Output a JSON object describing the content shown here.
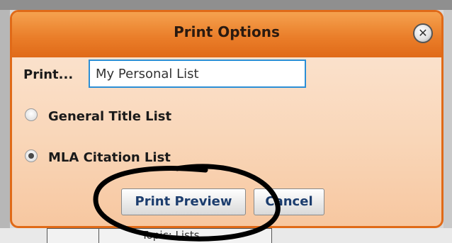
{
  "dialog": {
    "title": "Print Options",
    "close_icon": "close-icon",
    "print_label": "Print...",
    "list_name_value": "My Personal List",
    "options": [
      {
        "label": "General Title List",
        "checked": false
      },
      {
        "label": "MLA Citation List",
        "checked": true
      }
    ],
    "buttons": {
      "print_preview": "Print Preview",
      "cancel": "Cancel"
    }
  },
  "background": {
    "partial_text": "Topic: Lists"
  },
  "colors": {
    "title_bar": "#ea7e2a",
    "dialog_body": "#f9d6b8",
    "input_border": "#2b8fd6",
    "annotation_ellipse": "#000000"
  }
}
